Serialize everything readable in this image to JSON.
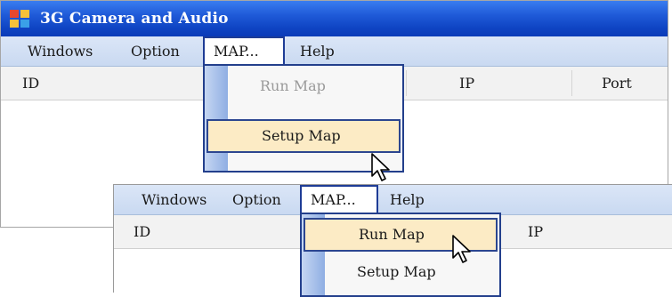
{
  "window": {
    "title": "3G Camera and Audio"
  },
  "menu": {
    "windows": "Windows",
    "option": "Option",
    "map": "MAP...",
    "help": "Help"
  },
  "map_dropdown": {
    "run_map": "Run Map",
    "setup_map": "Setup Map"
  },
  "columns": {
    "id": "ID",
    "ip": "IP",
    "port": "Port"
  },
  "states": {
    "first": {
      "highlighted": "Setup Map",
      "disabled": "Run Map"
    },
    "second": {
      "highlighted": "Run Map"
    }
  },
  "colors": {
    "titlebar": "#1f5ad8",
    "menubar": "#d0def4",
    "highlight": "#fcebc5",
    "menu_border": "#233f8c"
  }
}
